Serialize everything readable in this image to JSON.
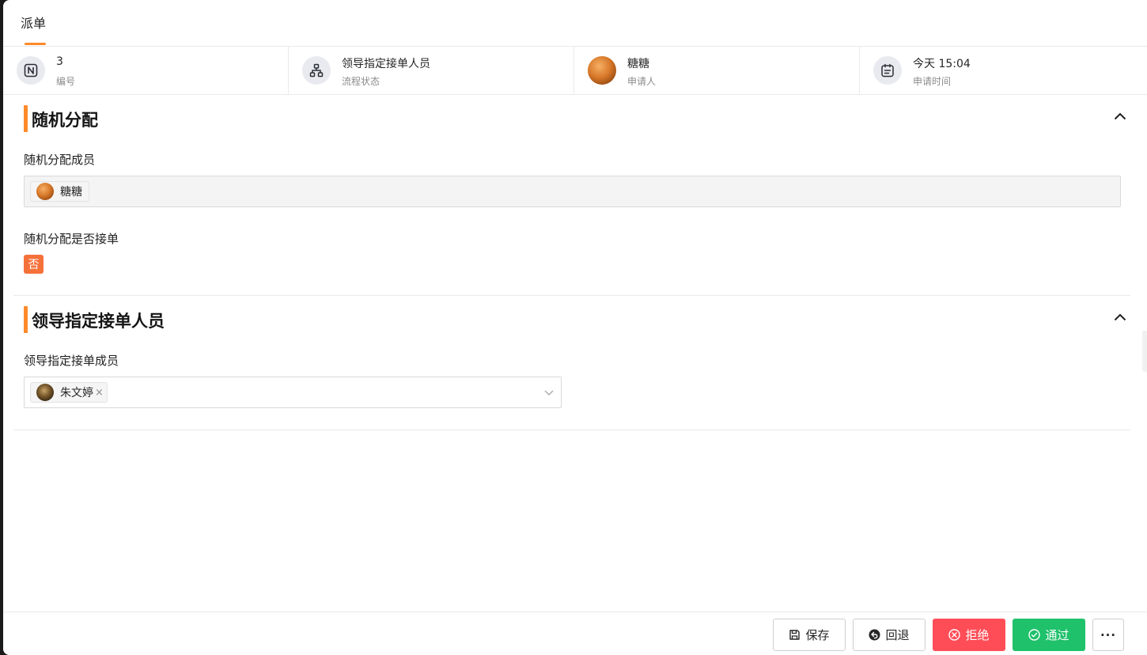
{
  "tab": {
    "title": "派单"
  },
  "info": [
    {
      "value": "3",
      "label": "编号",
      "icon": "notion-n-icon"
    },
    {
      "value": "领导指定接单人员",
      "label": "流程状态",
      "icon": "flow-tree-icon"
    },
    {
      "value": "糖糖",
      "label": "申请人",
      "icon": "avatar"
    },
    {
      "value": "今天 15:04",
      "label": "申请时间",
      "icon": "calendar-icon"
    }
  ],
  "section_random": {
    "title": "随机分配",
    "members_label": "随机分配成员",
    "members": [
      "糖糖"
    ],
    "accept_label": "随机分配是否接单",
    "accept_value": "否"
  },
  "section_leader": {
    "title": "领导指定接单人员",
    "members_label": "领导指定接单成员",
    "selected": [
      "朱文婷"
    ],
    "remove_symbol": "×"
  },
  "footer": {
    "save": "保存",
    "back": "回退",
    "reject": "拒绝",
    "approve": "通过",
    "more": "···"
  },
  "colors": {
    "accent": "#ff8a2b",
    "danger": "#ff4d57",
    "success": "#1fc16b",
    "tag_no": "#f5713a"
  }
}
